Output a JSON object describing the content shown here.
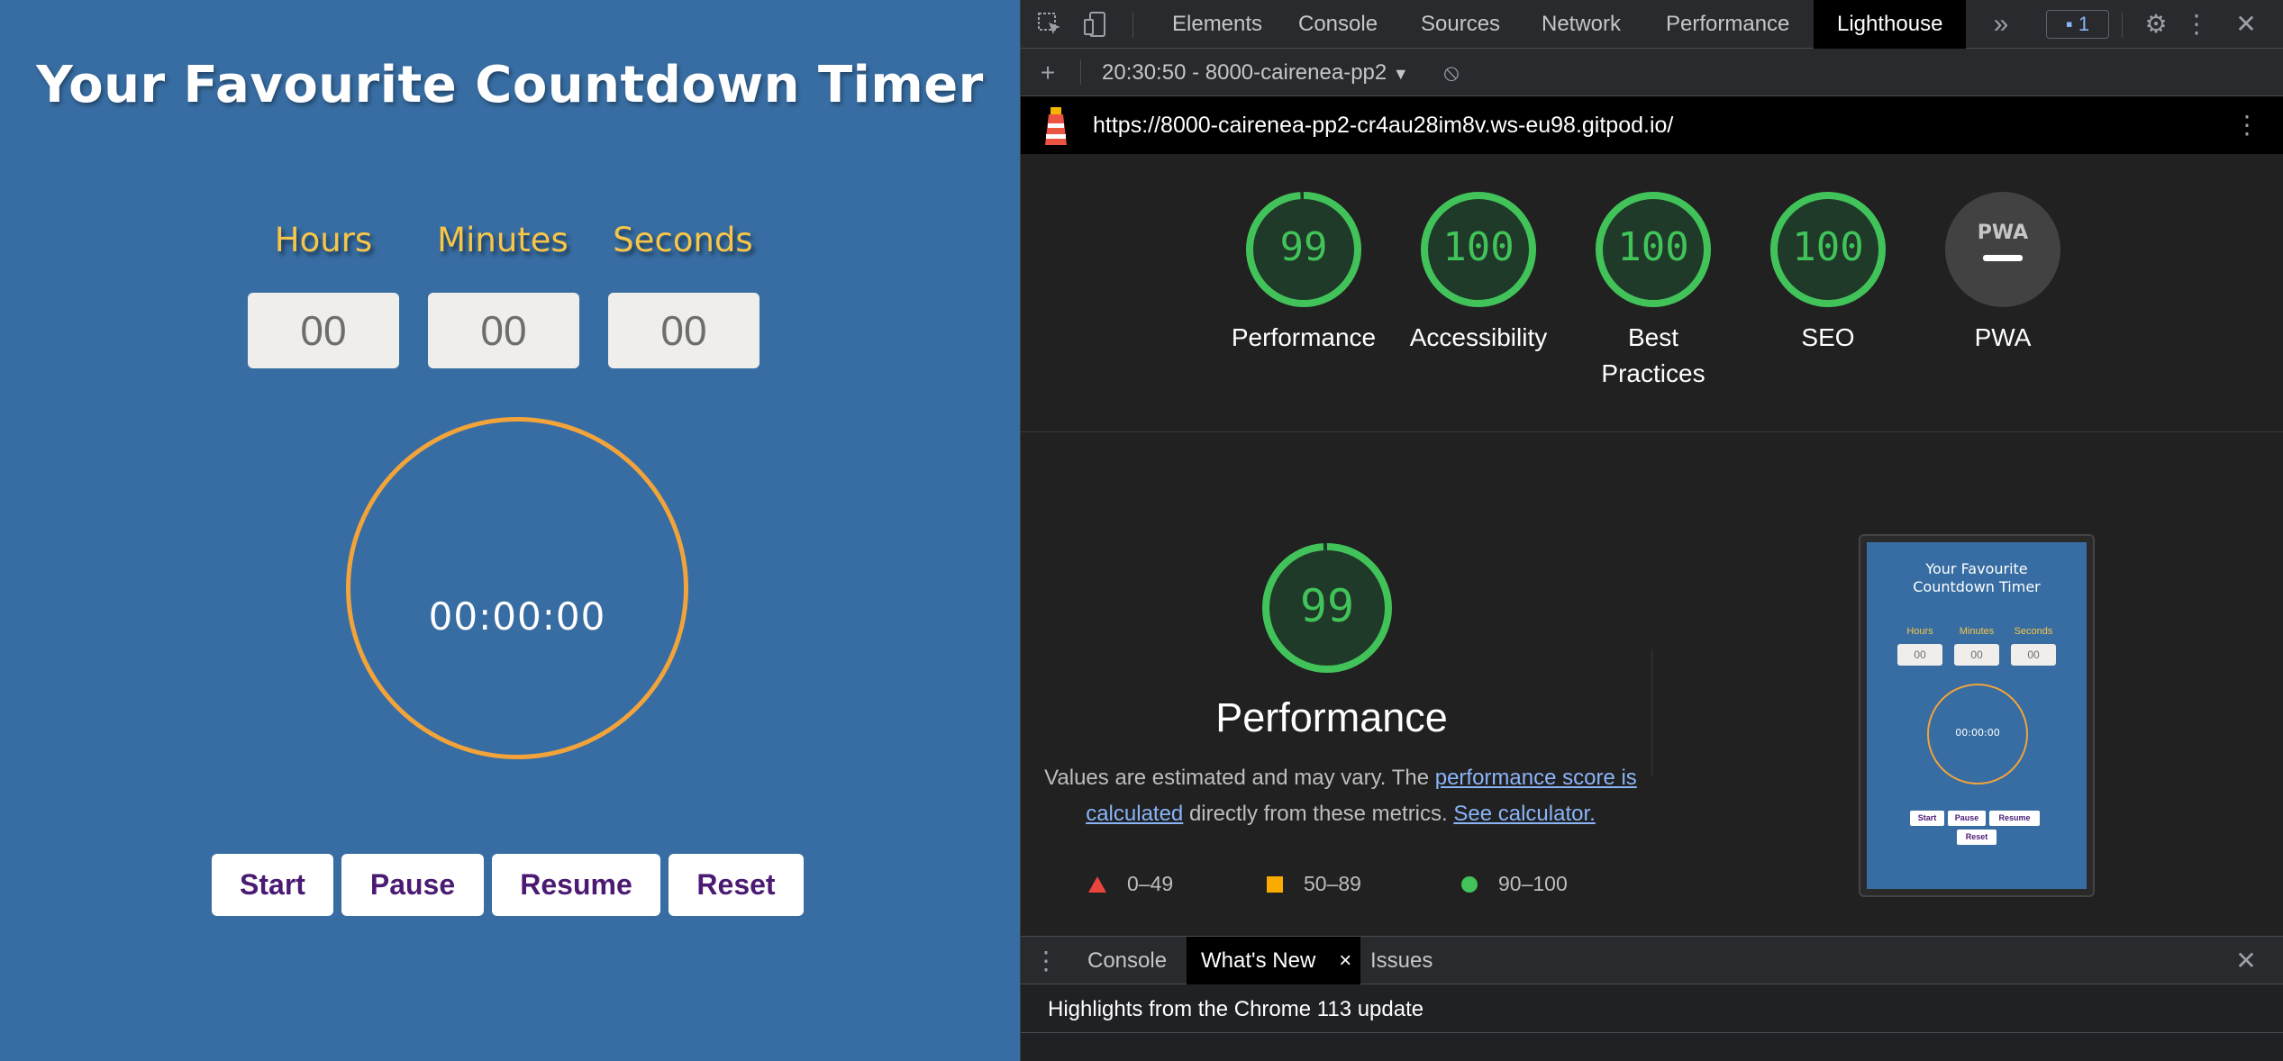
{
  "app": {
    "title": "Your Favourite Countdown Timer",
    "labels": {
      "hours": "Hours",
      "minutes": "Minutes",
      "seconds": "Seconds"
    },
    "inputs": {
      "hours": "00",
      "minutes": "00",
      "seconds": "00"
    },
    "display": "00:00:00",
    "buttons": {
      "start": "Start",
      "pause": "Pause",
      "resume": "Resume",
      "reset": "Reset"
    },
    "colors": {
      "background": "#376da2",
      "label": "#f7c548",
      "ring": "#f2a33a",
      "button_text": "#4b1a73"
    }
  },
  "devtools": {
    "tabs": [
      "Elements",
      "Console",
      "Sources",
      "Network",
      "Performance",
      "Lighthouse"
    ],
    "active_tab": "Lighthouse",
    "more_tabs_icon": "»",
    "issues_count": "1",
    "report_select": "20:30:50 - 8000-cairenea-pp2",
    "url": "https://8000-cairenea-pp2-cr4au28im8v.ws-eu98.gitpod.io/",
    "scores": [
      {
        "label": "Performance",
        "value": "99",
        "fraction": 0.99
      },
      {
        "label": "Accessibility",
        "value": "100",
        "fraction": 1.0
      },
      {
        "label": "Best Practices",
        "value": "100",
        "fraction": 1.0
      },
      {
        "label": "SEO",
        "value": "100",
        "fraction": 1.0
      },
      {
        "label": "PWA",
        "value": "PWA",
        "fraction": 0
      }
    ],
    "performance_section": {
      "score": "99",
      "heading": "Performance",
      "desc_prefix": "Values are estimated and may vary. The ",
      "link1": "performance score is calculated",
      "desc_middle": " directly from these metrics. ",
      "link2": "See calculator."
    },
    "legend": [
      {
        "range": "0–49",
        "color": "#e8453c"
      },
      {
        "range": "50–89",
        "color": "#f9ab00"
      },
      {
        "range": "90–100",
        "color": "#41c35a"
      }
    ],
    "preview": {
      "title_line1": "Your Favourite",
      "title_line2": "Countdown Timer",
      "labels": [
        "Hours",
        "Minutes",
        "Seconds"
      ],
      "inputs": [
        "00",
        "00",
        "00"
      ],
      "display": "00:00:00",
      "buttons": [
        "Start",
        "Pause",
        "Resume",
        "Reset"
      ]
    },
    "drawer": {
      "tabs": [
        "Console",
        "What's New",
        "Issues"
      ],
      "active_tab": "What's New",
      "close_tab": "×",
      "content": "Highlights from the Chrome 113 update"
    },
    "colors": {
      "pass": "#0cce6b",
      "pass_fill": "#1f3a28",
      "pwa_fill": "#424242"
    }
  }
}
